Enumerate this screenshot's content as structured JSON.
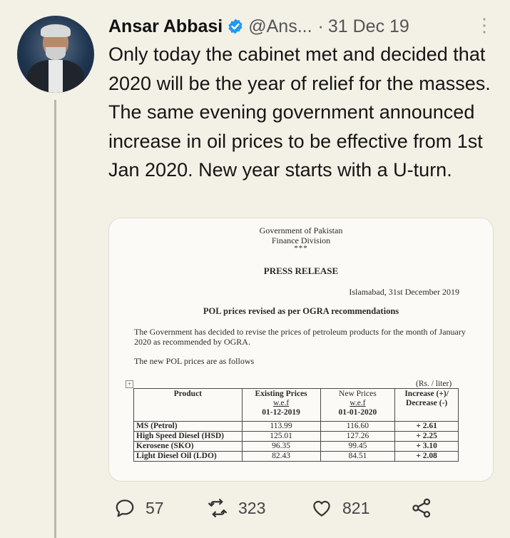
{
  "tweet": {
    "author_name": "Ansar Abbasi",
    "handle": "@Ans...",
    "separator": "·",
    "date": "31 Dec 19",
    "text": "Only today the cabinet met and decided that 2020 will be the year of relief for the masses. The same evening government announced increase in oil prices to be effective from 1st Jan 2020. New year starts with a U-turn."
  },
  "document": {
    "org_line1": "Government of Pakistan",
    "org_line2": "Finance Division",
    "stars": "***",
    "heading": "PRESS RELEASE",
    "place_date": "Islamabad, 31st December 2019",
    "subject": "POL prices revised as per OGRA recommendations",
    "paragraph": "The Government has decided to revise the prices of petroleum products for the month of January 2020 as recommended by OGRA.",
    "paragraph2": "The new POL prices are as follows",
    "unit": "(Rs. / liter)",
    "table": {
      "headers": {
        "product": "Product",
        "existing": "Existing Prices",
        "existing_wef": "w.e.f",
        "existing_date": "01-12-2019",
        "new": "New Prices",
        "new_wef": "w.e.f",
        "new_date": "01-01-2020",
        "change": "Increase (+)/ Decrease (-)"
      },
      "rows": [
        {
          "product": "MS (Petrol)",
          "existing": "113.99",
          "new": "116.60",
          "change": "+ 2.61"
        },
        {
          "product": "High Speed Diesel (HSD)",
          "existing": "125.01",
          "new": "127.26",
          "change": "+ 2.25"
        },
        {
          "product": "Kerosene (SKO)",
          "existing": "96.35",
          "new": "99.45",
          "change": "+ 3.10"
        },
        {
          "product": "Light Diesel Oil (LDO)",
          "existing": "82.43",
          "new": "84.51",
          "change": "+ 2.08"
        }
      ]
    }
  },
  "actions": {
    "replies": "57",
    "retweets": "323",
    "likes": "821"
  },
  "icons": {
    "verified": "verified-badge-icon",
    "more": "more-vertical-icon",
    "reply": "reply-icon",
    "retweet": "retweet-icon",
    "like": "heart-icon",
    "share": "share-icon"
  },
  "colors": {
    "background": "#f3f0e6",
    "verified": "#1d9bf0",
    "text": "#151515",
    "muted": "#555555"
  }
}
